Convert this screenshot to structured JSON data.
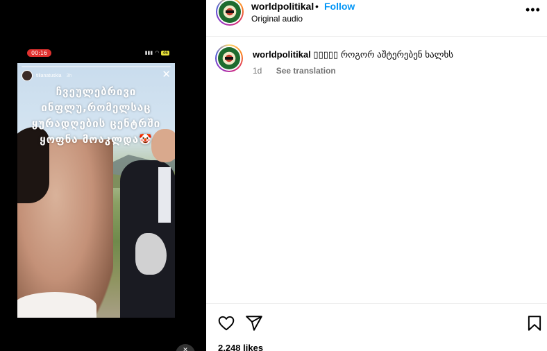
{
  "story": {
    "status_time": "00:16",
    "battery": "46",
    "author": "tilianatuskia",
    "age": "3h",
    "caption_lines": [
      "ჩვეულებრივი",
      "ინფლუ,რომელსაც",
      "ყურადღების  ცენტრში",
      "ყოფნა  მოაკლდა🤡"
    ]
  },
  "header": {
    "username": "worldpolitikal",
    "separator": "•",
    "follow_label": "Follow",
    "audio": "Original audio",
    "more_icon": "more-horizontal-icon"
  },
  "comment": {
    "username": "worldpolitikal",
    "text": " ▯▯▯▯▯ როგორ აშტერებენ ხალხს",
    "age": "1d",
    "translate_label": "See translation"
  },
  "actions": {
    "likes": "2,248 likes"
  }
}
